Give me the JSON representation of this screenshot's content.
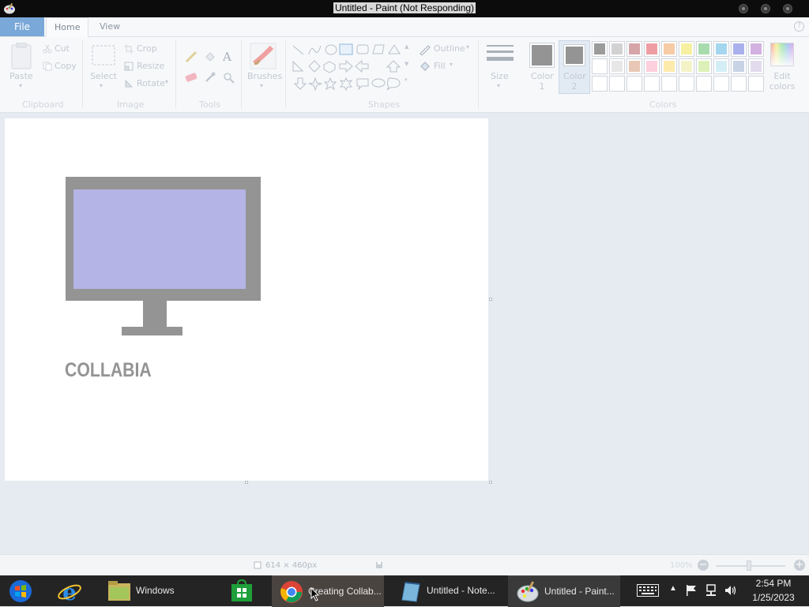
{
  "window": {
    "title": "Untitled - Paint (Not Responding)"
  },
  "tabs": {
    "file": "File",
    "home": "Home",
    "view": "View"
  },
  "ribbon": {
    "clipboard": {
      "paste": "Paste",
      "cut": "Cut",
      "copy": "Copy",
      "group": "Clipboard"
    },
    "image": {
      "select": "Select",
      "crop": "Crop",
      "resize": "Resize",
      "rotate": "Rotate",
      "group": "Image"
    },
    "tools": {
      "group": "Tools"
    },
    "brushes": {
      "label": "Brushes"
    },
    "shapes": {
      "outline": "Outline",
      "fill": "Fill",
      "group": "Shapes"
    },
    "size": {
      "label": "Size"
    },
    "color1": {
      "label": "Color 1",
      "line1": "Color",
      "line2": "1"
    },
    "color2": {
      "label": "Color 2",
      "line1": "Color",
      "line2": "2"
    },
    "colors": {
      "group": "Colors"
    },
    "edit_colors": {
      "line1": "Edit",
      "line2": "colors"
    }
  },
  "palette": {
    "row1": [
      "#9b9b9b",
      "#d2d2d2",
      "#d6a5a8",
      "#ee9ea3",
      "#f6cba5",
      "#f6f0a0",
      "#a8dcae",
      "#a5d6ef",
      "#a9b1ec",
      "#d3b1e0"
    ],
    "row2": [
      "#ffffff",
      "#e7e7e7",
      "#e8c7b5",
      "#fcd0dc",
      "#fcebac",
      "#f4f3c8",
      "#dcf0b8",
      "#d4eef5",
      "#c9d3e6",
      "#e2dbee"
    ],
    "row3": [
      "#ffffff",
      "#ffffff",
      "#ffffff",
      "#ffffff",
      "#ffffff",
      "#ffffff",
      "#ffffff",
      "#ffffff",
      "#ffffff",
      "#ffffff"
    ]
  },
  "canvas": {
    "logo_text": "COLLABIA",
    "monitor_frame_color": "#949494",
    "monitor_screen_color": "#b4b4e6"
  },
  "status": {
    "dimensions": "614 × 460px",
    "zoom": "100%"
  },
  "taskbar": {
    "items": [
      {
        "label": "Windows"
      },
      {
        "label": "Creating Collab..."
      },
      {
        "label": "Untitled - Note..."
      },
      {
        "label": "Untitled - Paint..."
      }
    ],
    "time": "2:54 PM",
    "date": "1/25/2023"
  }
}
